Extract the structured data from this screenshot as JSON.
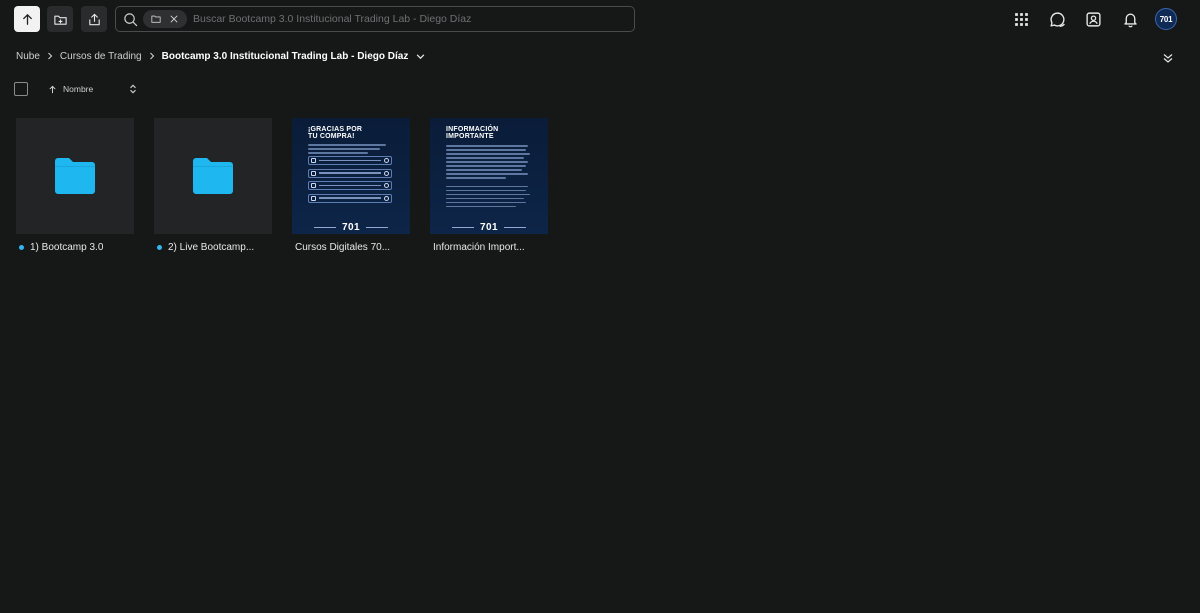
{
  "toolbar": {
    "upload_icon": "upload-arrow-icon",
    "new_folder_icon": "folder-plus-icon",
    "share_icon": "share-icon"
  },
  "search": {
    "placeholder": "Buscar Bootcamp 3.0 Institucional Trading Lab - Diego Díaz",
    "value": "",
    "scope_chip_icon": "folder-icon"
  },
  "header_icons": [
    "apps-grid-icon",
    "chat-icon",
    "contacts-icon",
    "bell-icon"
  ],
  "user": {
    "avatar_text": "701",
    "avatar_color": "#0e2a55"
  },
  "breadcrumb": {
    "items": [
      "Nube",
      "Cursos de Trading"
    ],
    "current": "Bootcamp 3.0 Institucional Trading Lab - Diego Díaz"
  },
  "sort": {
    "label": "Nombre",
    "direction": "ascending"
  },
  "files": [
    {
      "name": "1) Bootcamp 3.0",
      "type": "folder",
      "new_dot": true
    },
    {
      "name": "2) Live Bootcamp...",
      "type": "folder",
      "new_dot": true
    },
    {
      "name": "Cursos Digitales 70...",
      "type": "image",
      "new_dot": false,
      "thumb_title": "¡GRACIAS POR\nTU COMPRA!",
      "thumb_brand": "701"
    },
    {
      "name": "Información Import...",
      "type": "image",
      "new_dot": false,
      "thumb_title": "INFORMACIÓN\nIMPORTANTE",
      "thumb_brand": "701"
    }
  ],
  "colors": {
    "background": "#161717",
    "folder": "#1fb7ef",
    "accent_dot": "#33b6f0",
    "poster_bg": "#0b1f3b"
  }
}
